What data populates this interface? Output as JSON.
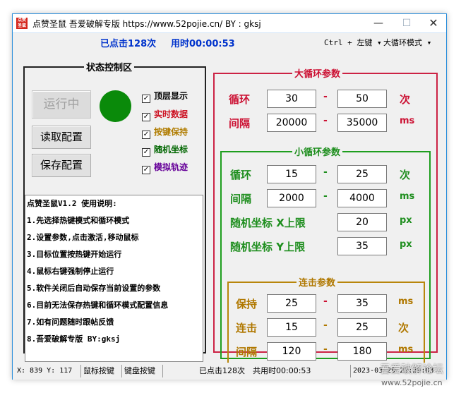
{
  "window": {
    "title": "点赞圣鼠    吾爱破解专版 https://www.52pojie.cn/   BY : gksj",
    "icon_text": "点赞圣鼠",
    "minimize": "—",
    "maximize": "☐",
    "close": "✕"
  },
  "topbar": {
    "click_count": "已点击128次",
    "elapsed": "用时00:00:53",
    "hotkey_combo": "Ctrl + 左键 ▾",
    "mode_combo": "大循环模式 ▾"
  },
  "state_panel": {
    "title": "状态控制区",
    "run_button": "运行中",
    "read_config_button": "读取配置",
    "save_config_button": "保存配置",
    "status_light_color": "#0a8a0a",
    "checkboxes": [
      {
        "label": "顶层显示",
        "checked": true,
        "color": "#000000"
      },
      {
        "label": "实时数据",
        "checked": true,
        "color": "#cc1122"
      },
      {
        "label": "按键保持",
        "checked": true,
        "color": "#b07c00"
      },
      {
        "label": "随机坐标",
        "checked": true,
        "color": "#006600"
      },
      {
        "label": "模拟轨迹",
        "checked": true,
        "color": "#660099"
      }
    ],
    "notes": [
      "点赞圣鼠V1.2  使用说明:",
      "1.先选择热键模式和循环模式",
      "2.设置参数,点击激活,移动鼠标",
      "3.目标位置按热键开始运行",
      "4.鼠标右键强制停止运行",
      "5.软件关闭后自动保存当前设置的参数",
      "6.目前无法保存热键和循环模式配置信息",
      "7.如有问题随时跟帖反馈",
      "8.吾爱破解专版 BY:gksj"
    ]
  },
  "big_loop": {
    "title": "大循环参数",
    "color": "#cc1133",
    "loop": {
      "label": "循环",
      "min": "30",
      "max": "50",
      "unit": "次"
    },
    "interval": {
      "label": "间隔",
      "min": "20000",
      "max": "35000",
      "unit": "ms"
    }
  },
  "small_loop": {
    "title": "小循环参数",
    "color": "#1e8e1e",
    "loop": {
      "label": "循环",
      "min": "15",
      "max": "25",
      "unit": "次"
    },
    "interval": {
      "label": "间隔",
      "min": "2000",
      "max": "4000",
      "unit": "ms"
    },
    "rand_x": {
      "label": "随机坐标  X上限",
      "value": "20",
      "unit": "px"
    },
    "rand_y": {
      "label": "随机坐标  Y上限",
      "value": "35",
      "unit": "px"
    }
  },
  "combo_click": {
    "title": "连击参数",
    "color": "#b07800",
    "hold": {
      "label": "保持",
      "min": "25",
      "max": "35",
      "unit": "ms"
    },
    "clicks": {
      "label": "连击",
      "min": "15",
      "max": "25",
      "unit": "次"
    },
    "interval": {
      "label": "间隔",
      "min": "120",
      "max": "180",
      "unit": "ms"
    }
  },
  "dash": "-",
  "statusbar": {
    "coords": "X: 839  Y: 117",
    "mouse_hotkey": "鼠标按键",
    "keyboard_hotkey": "键盘按键",
    "click_count": "已点击128次",
    "total_time": "共用时00:00:53",
    "datetime": "2023-03-29 22:29:03"
  },
  "watermark": {
    "text": "吾爱破解论坛",
    "url": "www.52pojie.cn"
  }
}
